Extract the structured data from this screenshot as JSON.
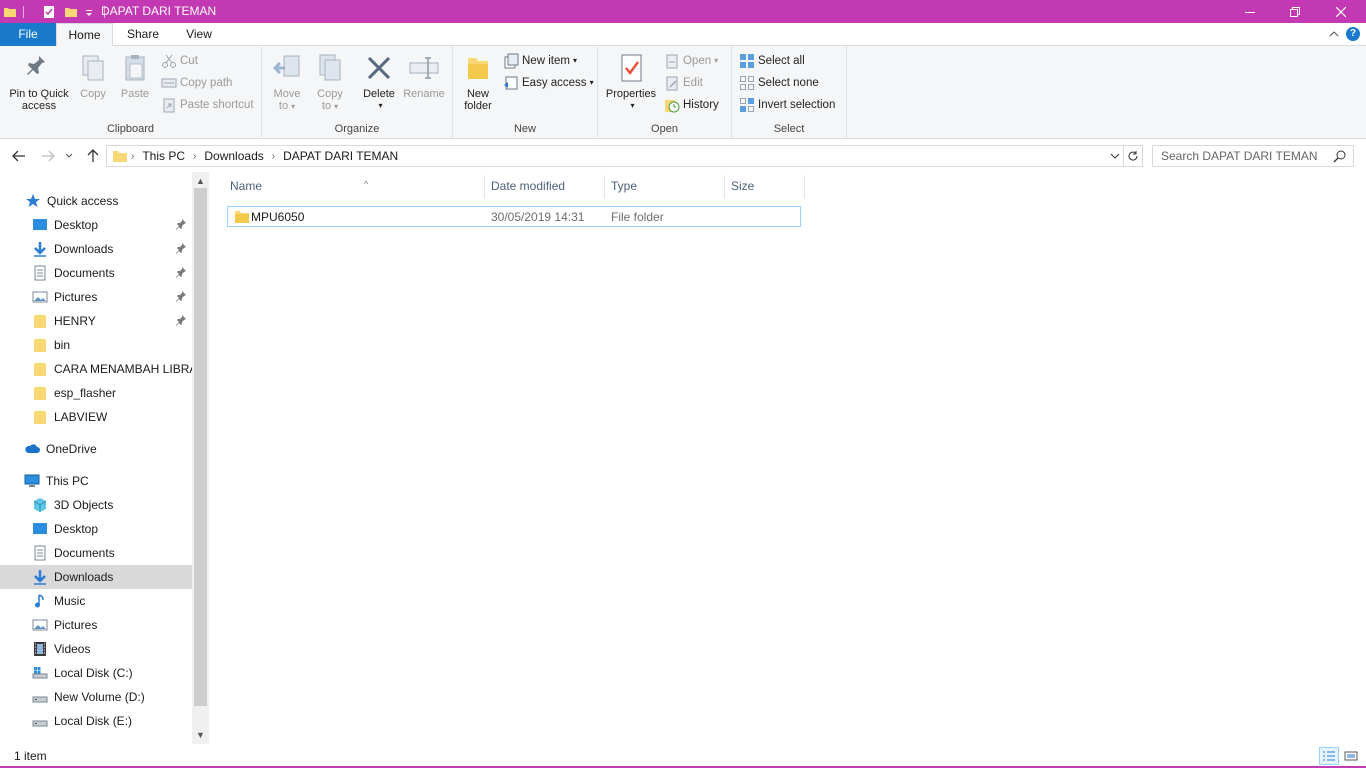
{
  "window": {
    "title": "DAPAT DARI TEMAN",
    "accent": "#c239b3"
  },
  "ribbon_tabs": {
    "file": "File",
    "home": "Home",
    "share": "Share",
    "view": "View"
  },
  "clipboard": {
    "pin": "Pin to Quick access",
    "pin_line1": "Pin to Quick",
    "pin_line2": "access",
    "copy": "Copy",
    "paste": "Paste",
    "cut": "Cut",
    "copy_path": "Copy path",
    "paste_shortcut": "Paste shortcut",
    "label": "Clipboard"
  },
  "organize": {
    "move_line1": "Move",
    "move_line2": "to",
    "copy_line1": "Copy",
    "copy_line2": "to",
    "delete": "Delete",
    "rename": "Rename",
    "label": "Organize"
  },
  "new_group": {
    "new_folder_line1": "New",
    "new_folder_line2": "folder",
    "new_item": "New item",
    "easy_access": "Easy access",
    "label": "New"
  },
  "open_group": {
    "properties": "Properties",
    "open": "Open",
    "edit": "Edit",
    "history": "History",
    "label": "Open"
  },
  "select_group": {
    "select_all": "Select all",
    "select_none": "Select none",
    "invert": "Invert selection",
    "label": "Select"
  },
  "address": {
    "crumbs": [
      "This PC",
      "Downloads",
      "DAPAT DARI TEMAN"
    ],
    "search_placeholder": "Search DAPAT DARI TEMAN"
  },
  "nav": {
    "quick_access": "Quick access",
    "quick_items": [
      {
        "label": "Desktop",
        "icon": "desktop-icon",
        "pinned": true
      },
      {
        "label": "Downloads",
        "icon": "downloads-icon",
        "pinned": true
      },
      {
        "label": "Documents",
        "icon": "documents-icon",
        "pinned": true
      },
      {
        "label": "Pictures",
        "icon": "pictures-icon",
        "pinned": true
      },
      {
        "label": "HENRY",
        "icon": "folder-icon",
        "pinned": true
      },
      {
        "label": "bin",
        "icon": "folder-icon",
        "pinned": false
      },
      {
        "label": "CARA MENAMBAH LIBRAI",
        "icon": "folder-icon",
        "pinned": false
      },
      {
        "label": "esp_flasher",
        "icon": "folder-icon",
        "pinned": false
      },
      {
        "label": "LABVIEW",
        "icon": "folder-icon",
        "pinned": false
      }
    ],
    "onedrive": "OneDrive",
    "this_pc": "This PC",
    "pc_items": [
      {
        "label": "3D Objects",
        "icon": "3d-objects-icon"
      },
      {
        "label": "Desktop",
        "icon": "desktop-icon"
      },
      {
        "label": "Documents",
        "icon": "documents-icon"
      },
      {
        "label": "Downloads",
        "icon": "downloads-icon",
        "selected": true
      },
      {
        "label": "Music",
        "icon": "music-icon"
      },
      {
        "label": "Pictures",
        "icon": "pictures-icon"
      },
      {
        "label": "Videos",
        "icon": "videos-icon"
      },
      {
        "label": "Local Disk (C:)",
        "icon": "drive-icon"
      },
      {
        "label": "New Volume (D:)",
        "icon": "drive-icon"
      },
      {
        "label": "Local Disk (E:)",
        "icon": "drive-icon"
      }
    ]
  },
  "columns": {
    "name": "Name",
    "date": "Date modified",
    "type": "Type",
    "size": "Size"
  },
  "files": [
    {
      "name": "MPU6050",
      "date": "30/05/2019 14:31",
      "type": "File folder",
      "size": ""
    }
  ],
  "status": {
    "count": "1 item"
  }
}
